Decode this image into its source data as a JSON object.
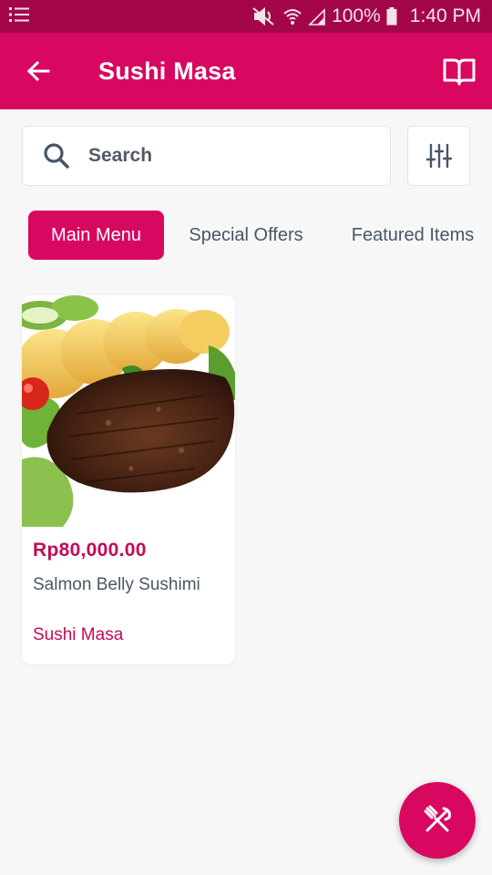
{
  "status_bar": {
    "battery": "100%",
    "time": "1:40 PM",
    "icons": [
      "menu-icon",
      "mute-icon",
      "wifi-icon",
      "signal-icon",
      "battery-icon"
    ]
  },
  "app_bar": {
    "title": "Sushi Masa",
    "back_icon": "arrow-left-icon",
    "action_icon": "book-open-icon"
  },
  "search": {
    "placeholder": "Search",
    "icon": "search-icon",
    "filter_icon": "sliders-icon"
  },
  "tabs": [
    {
      "label": "Main Menu",
      "active": true
    },
    {
      "label": "Special Offers",
      "active": false
    },
    {
      "label": "Featured Items",
      "active": false
    }
  ],
  "products": [
    {
      "price": "Rp80,000.00",
      "name": "Salmon Belly Sushimi",
      "store": "Sushi Masa",
      "image_alt": "steak-with-potatoes-photo"
    }
  ],
  "fab": {
    "icon": "fork-knife-icon"
  },
  "colors": {
    "primary": "#d80760",
    "status_bar": "#a3074a",
    "price": "#c20a56",
    "text": "#4a5763",
    "background": "#f7f7f8"
  }
}
